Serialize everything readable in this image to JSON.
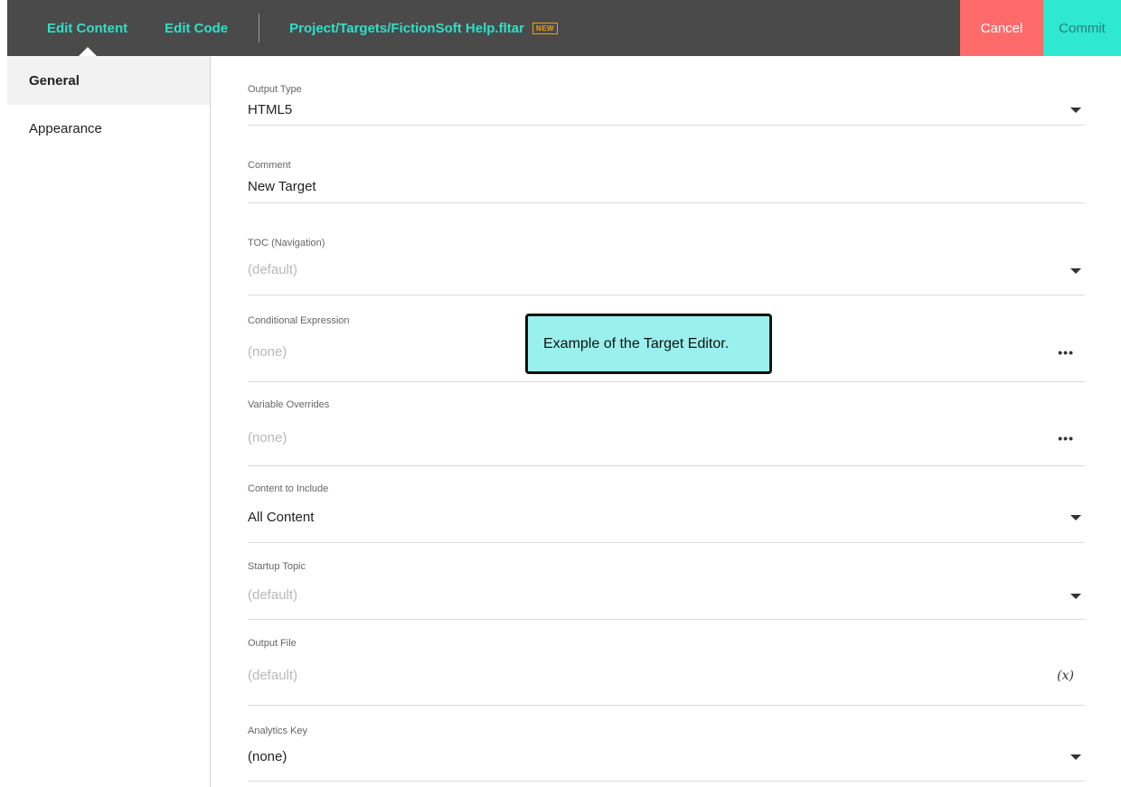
{
  "topbar": {
    "tabs": [
      {
        "label": "Edit Content"
      },
      {
        "label": "Edit Code"
      }
    ],
    "path": "Project/Targets/FictionSoft Help.fltar",
    "badge": "NEW",
    "cancel_label": "Cancel",
    "commit_label": "Commit"
  },
  "sidebar": {
    "items": [
      {
        "label": "General"
      },
      {
        "label": "Appearance"
      }
    ]
  },
  "fields": [
    {
      "label": "Output Type",
      "value": "HTML5",
      "control": "dropdown"
    },
    {
      "label": "Comment",
      "value": "New Target",
      "control": "text"
    },
    {
      "label": "TOC (Navigation)",
      "value": "(default)",
      "control": "dropdown"
    },
    {
      "label": "Conditional Expression",
      "value": "(none)",
      "control": "ellipsis",
      "ellipsis": "•••"
    },
    {
      "label": "Variable Overrides",
      "value": "(none)",
      "control": "ellipsis",
      "ellipsis": "•••"
    },
    {
      "label": "Content to Include",
      "value": "All Content",
      "control": "dropdown"
    },
    {
      "label": "Startup Topic",
      "value": "(default)",
      "control": "dropdown"
    },
    {
      "label": "Output File",
      "value": "(default)",
      "control": "variable",
      "variable_symbol": "(x)"
    },
    {
      "label": "Analytics Key",
      "value": "(none)",
      "control": "dropdown"
    }
  ],
  "callout": {
    "text": "Example of the Target Editor."
  },
  "colors": {
    "topbar_bg": "#4a4a4a",
    "accent": "#2fe0c9",
    "cancel_bg": "#ff6b6b",
    "commit_bg": "#2ee8d0",
    "badge": "#e8a317",
    "callout_bg": "#9af0ec"
  }
}
